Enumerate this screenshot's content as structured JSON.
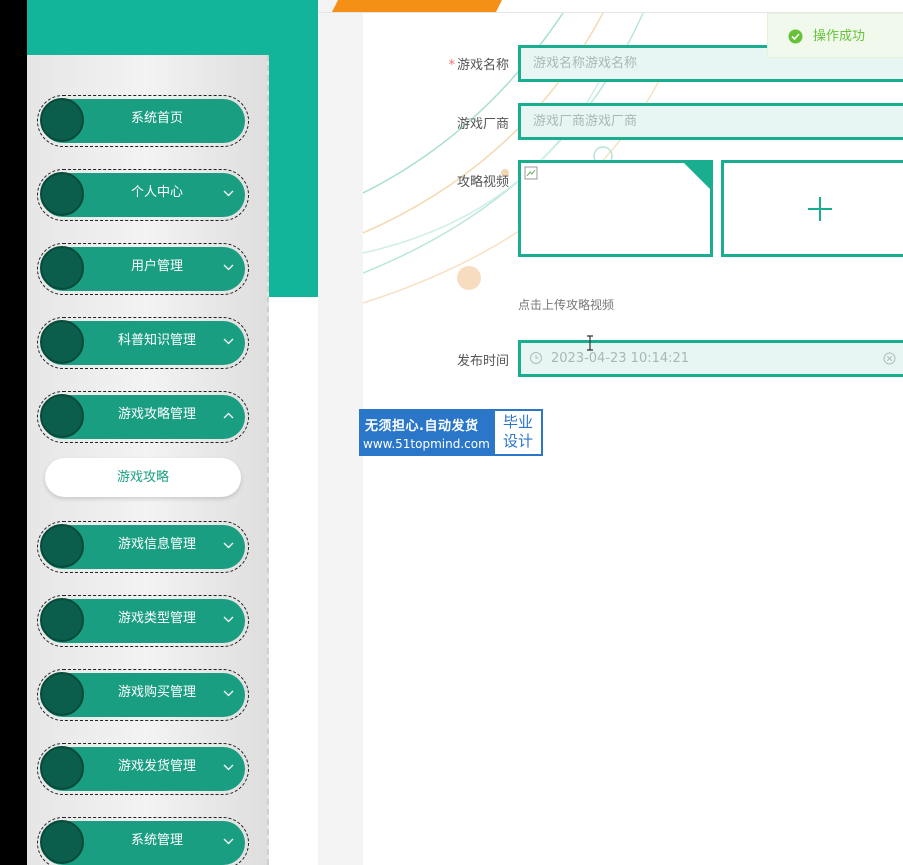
{
  "sidebar": {
    "items": [
      {
        "label": "系统首页",
        "expandable": false
      },
      {
        "label": "个人中心",
        "expandable": true
      },
      {
        "label": "用户管理",
        "expandable": true
      },
      {
        "label": "科普知识管理",
        "expandable": true
      },
      {
        "label": "游戏攻略管理",
        "expandable": true,
        "expanded": true
      },
      {
        "label": "游戏信息管理",
        "expandable": true
      },
      {
        "label": "游戏类型管理",
        "expandable": true
      },
      {
        "label": "游戏购买管理",
        "expandable": true
      },
      {
        "label": "游戏发货管理",
        "expandable": true
      },
      {
        "label": "系统管理",
        "expandable": true
      }
    ],
    "submenu": {
      "label": "游戏攻略"
    }
  },
  "form": {
    "game_name": {
      "label": "游戏名称",
      "required_mark": "*",
      "placeholder": "游戏名称游戏名称"
    },
    "vendor": {
      "label": "游戏厂商",
      "placeholder": "游戏厂商游戏厂商"
    },
    "video": {
      "label": "攻略视频",
      "hint": "点击上传攻略视频",
      "upload_icon": "plus-icon"
    },
    "publish_time": {
      "label": "发布时间",
      "value": "2023-04-23 10:14:21",
      "icon": "clock-icon"
    }
  },
  "toast": {
    "text": "操作成功",
    "icon": "success-check-icon"
  },
  "watermark": {
    "line1": "无须担心.自动发货",
    "line2": "www.51topmind.com",
    "right_line1": "毕业",
    "right_line2": "设计"
  },
  "colors": {
    "accent": "#1aae91",
    "sidebar_pill": "#1a9e82",
    "teal_block": "#12b59a",
    "orange": "#f39015",
    "success": "#67c23a"
  }
}
